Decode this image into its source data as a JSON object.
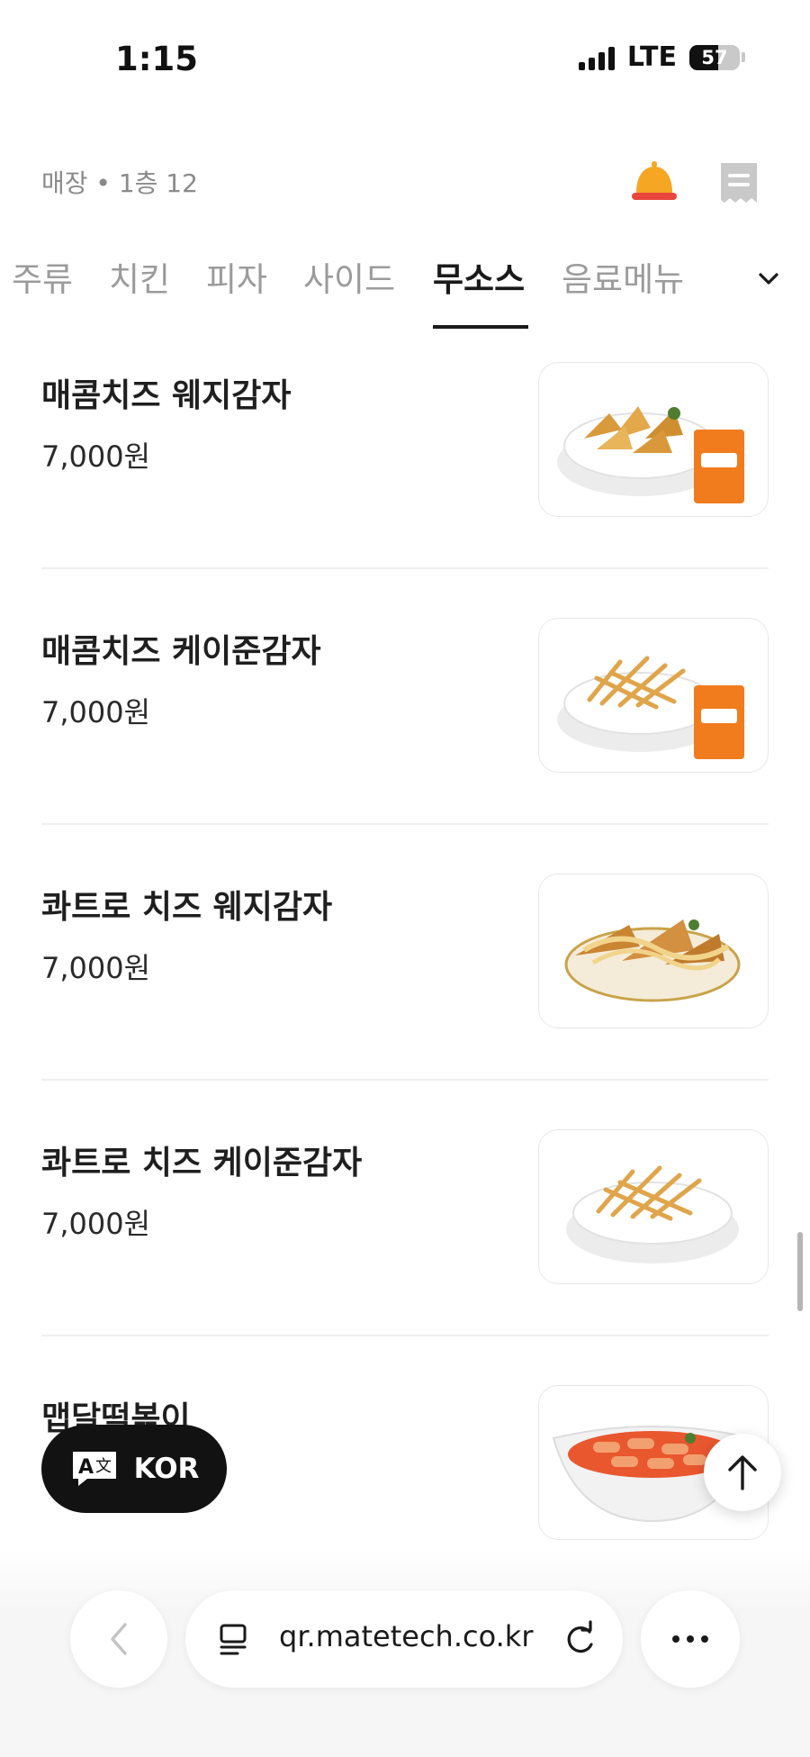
{
  "status_bar": {
    "time": "1:15",
    "network": "LTE",
    "battery": "57",
    "battery_level": 0.57
  },
  "header": {
    "store_label": "매장 • 1층 12"
  },
  "tabs": [
    {
      "label": "주류",
      "active": false
    },
    {
      "label": "치킨",
      "active": false
    },
    {
      "label": "피자",
      "active": false
    },
    {
      "label": "사이드",
      "active": false
    },
    {
      "label": "무소스",
      "active": true
    },
    {
      "label": "음료메뉴",
      "active": false
    }
  ],
  "menu_items": [
    {
      "name": "매콤치즈 웨지감자",
      "price": "7,000원",
      "image": "wedge-potato-with-cheese-sauce-packet"
    },
    {
      "name": "매콤치즈 케이준감자",
      "price": "7,000원",
      "image": "cajun-fries-with-cheese-sauce-packet"
    },
    {
      "name": "콰트로 치즈 웨지감자",
      "price": "7,000원",
      "image": "wedge-potato-with-cheese-drizzle"
    },
    {
      "name": "콰트로 치즈 케이준감자",
      "price": "7,000원",
      "image": "cajun-fries-in-bowl"
    },
    {
      "name": "맵달떡볶이",
      "price": "",
      "image": "tteokbokki-in-bowl"
    }
  ],
  "language_button": {
    "label": "KOR"
  },
  "browser": {
    "url": "qr.matetech.co.kr"
  },
  "colors": {
    "accent": "#f5a623",
    "text": "#1f1f1f",
    "muted": "#9b9b9b"
  }
}
